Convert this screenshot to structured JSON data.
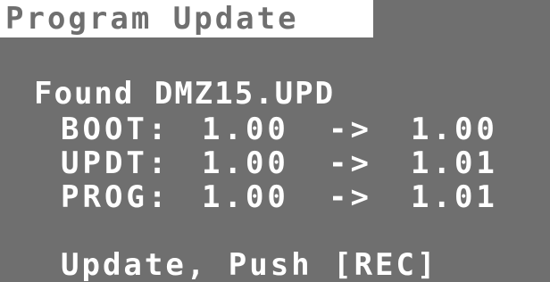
{
  "title": "Program Update",
  "found": {
    "label": "Found",
    "file": "DMZ15.UPD"
  },
  "versions": [
    {
      "label": "BOOT:",
      "current": "1.00",
      "arrow": "->",
      "new": "1.00"
    },
    {
      "label": "UPDT:",
      "current": "1.00",
      "arrow": "->",
      "new": "1.01"
    },
    {
      "label": "PROG:",
      "current": "1.00",
      "arrow": "->",
      "new": "1.01"
    }
  ],
  "prompt": "Update, Push [REC]",
  "colors": {
    "background": "#6f6f6f",
    "text": "#ffffff"
  }
}
